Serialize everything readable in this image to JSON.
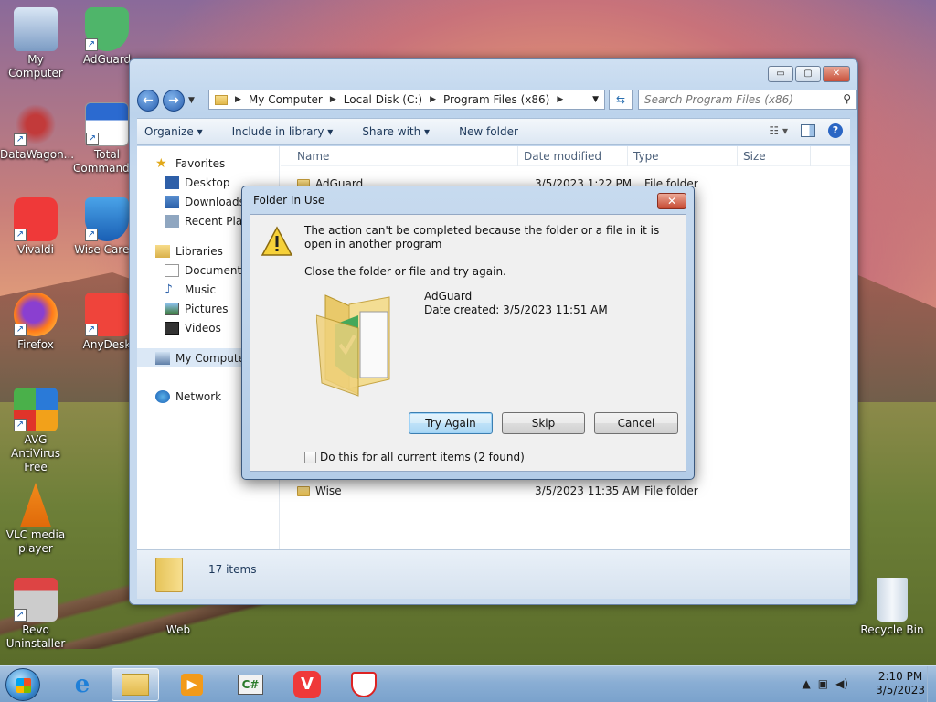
{
  "desktop": {
    "icons": [
      {
        "label": "My Computer"
      },
      {
        "label": "AdGuard"
      },
      {
        "label": "DataWagon..."
      },
      {
        "label": "Total Commander"
      },
      {
        "label": "Vivaldi"
      },
      {
        "label": "Wise Care 3"
      },
      {
        "label": "Firefox"
      },
      {
        "label": "AnyDesk"
      },
      {
        "label": "AVG AntiVirus Free"
      },
      {
        "label": "VLC media player"
      },
      {
        "label": "Revo Uninstaller"
      },
      {
        "label": "Web"
      },
      {
        "label": "Recycle Bin"
      }
    ]
  },
  "explorer": {
    "caption_buttons": {
      "minimize": "▭",
      "maximize": "▢",
      "close": "✕"
    },
    "breadcrumb": [
      "My Computer",
      "Local Disk (C:)",
      "Program Files (x86)"
    ],
    "search_placeholder": "Search Program Files (x86)",
    "toolbar": {
      "organize": "Organize ▾",
      "include": "Include in library ▾",
      "share": "Share with ▾",
      "new_folder": "New folder"
    },
    "nav": {
      "favorites": "Favorites",
      "desktop": "Desktop",
      "downloads": "Downloads",
      "recent": "Recent Places",
      "libraries": "Libraries",
      "documents": "Documents",
      "music": "Music",
      "pictures": "Pictures",
      "videos": "Videos",
      "my_computer": "My Computer",
      "network": "Network"
    },
    "columns": {
      "name": "Name",
      "date": "Date modified",
      "type": "Type",
      "size": "Size"
    },
    "rows": [
      {
        "name": "AdGuard",
        "date": "3/5/2023 1:22 PM",
        "type": "File folder"
      },
      {
        "name": "Wise",
        "date": "3/5/2023 11:35 AM",
        "type": "File folder"
      }
    ],
    "status": "17 items"
  },
  "dialog": {
    "title": "Folder In Use",
    "close": "✕",
    "message": "The action can't be completed because the folder or a file in it is open in another program",
    "instruction": "Close the folder or file and try again.",
    "file_name": "AdGuard",
    "file_created": "Date created: 3/5/2023 11:51 AM",
    "buttons": {
      "try_again": "Try Again",
      "skip": "Skip",
      "cancel": "Cancel"
    },
    "checkbox_label": "Do this for all current items (2 found)"
  },
  "taskbar": {
    "time": "2:10 PM",
    "date": "3/5/2023"
  }
}
